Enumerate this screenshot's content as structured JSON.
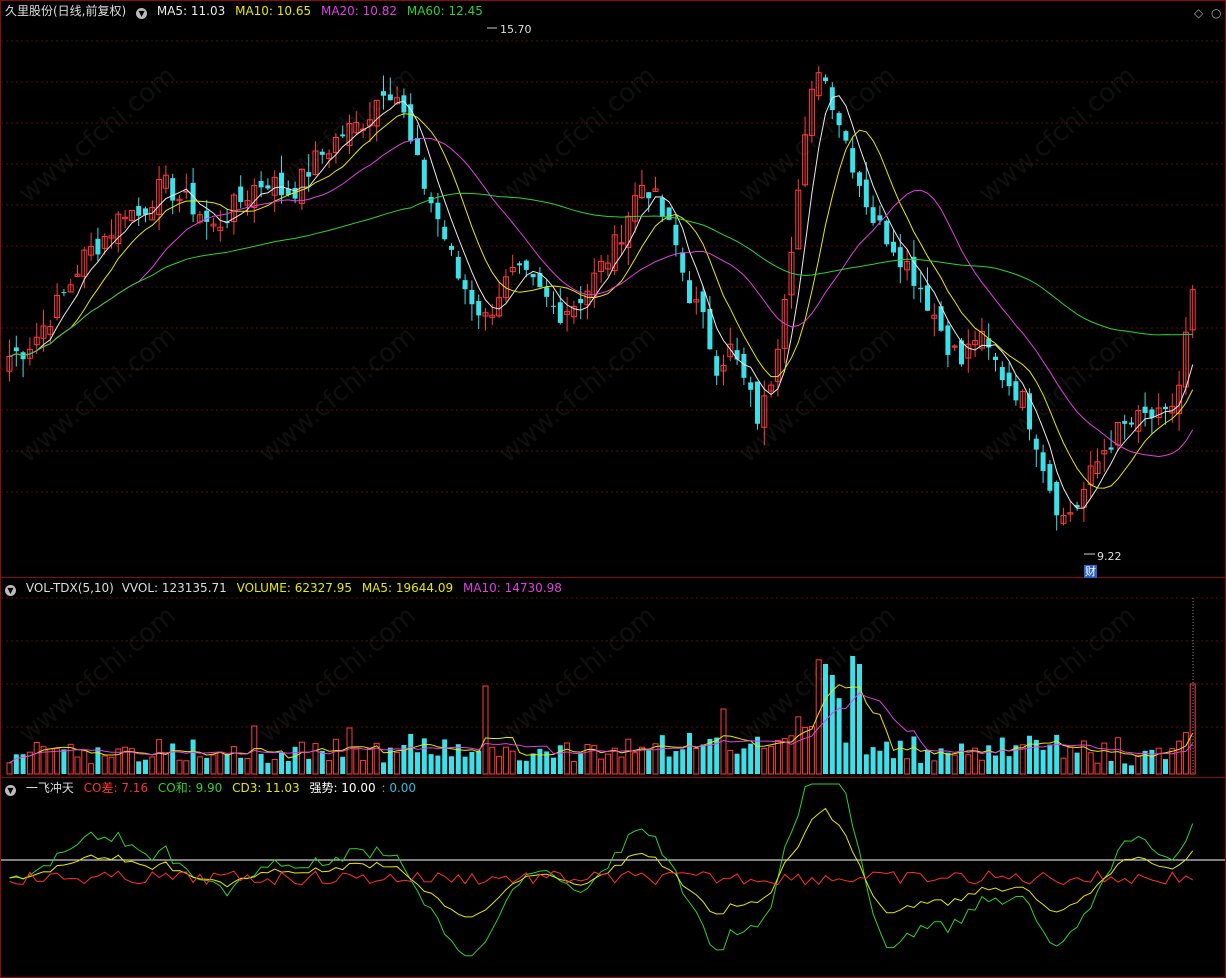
{
  "main": {
    "title": "久里股份(日线,前复权)",
    "ma": [
      {
        "label": "MA5: 11.03",
        "color": "#e9e9e9"
      },
      {
        "label": "MA10: 10.65",
        "color": "#e8e800"
      },
      {
        "label": "MA20: 10.82",
        "color": "#e040e0"
      },
      {
        "label": "MA60: 12.45",
        "color": "#30d030"
      }
    ],
    "high_label": "15.70",
    "low_label": "9.22",
    "marker": "财"
  },
  "volume": {
    "title": "VOL-TDX(5,10)",
    "vvol": "VVOL: 123135.71",
    "volume": "VOLUME: 62327.95",
    "ma5": "MA5: 19644.09",
    "ma10": "MA10: 14730.98",
    "colors": {
      "volume": "#e8e800",
      "ma5": "#e8e800",
      "ma10": "#e040e0"
    }
  },
  "indicator": {
    "title": "一飞冲天",
    "co_cha": "CO差: 7.16",
    "co_he": "CO和: 9.90",
    "cd3": "CD3: 11.03",
    "qiangshi": "强势: 10.00",
    "zero": ": 0.00",
    "colors": {
      "co_cha": "#ff3030",
      "co_he": "#30d030",
      "cd3": "#e8e800",
      "qiangshi": "#ffffff",
      "zero": "#30c0e0"
    }
  },
  "watermark": "www.cfchi.com",
  "chart_data": {
    "type": "candlestick",
    "ylim": [
      9.22,
      15.7
    ],
    "annotations": [
      "15.70",
      "9.22"
    ],
    "close_trend": [
      11.5,
      11.6,
      11.8,
      12.1,
      12.4,
      12.8,
      13.0,
      13.2,
      13.5,
      13.4,
      13.7,
      13.8,
      13.6,
      13.5,
      13.2,
      13.4,
      13.6,
      13.8,
      13.9,
      13.7,
      13.8,
      14.1,
      14.3,
      14.5,
      14.6,
      14.8,
      15.2,
      15.0,
      14.2,
      13.7,
      13.2,
      12.6,
      12.3,
      12.0,
      12.4,
      12.6,
      12.5,
      12.3,
      12.1,
      12.2,
      12.4,
      12.7,
      13.0,
      13.5,
      13.9,
      13.5,
      13.1,
      12.4,
      12.0,
      11.4,
      11.6,
      11.1,
      10.6,
      11.4,
      12.8,
      14.2,
      15.5,
      15.0,
      14.4,
      13.8,
      13.3,
      13.1,
      12.8,
      12.5,
      12.1,
      11.7,
      11.4,
      11.8,
      11.5,
      11.2,
      11.0,
      10.5,
      9.8,
      9.3,
      9.5,
      9.9,
      10.3,
      10.5,
      10.6,
      10.7,
      10.6,
      11.03,
      12.4
    ]
  }
}
